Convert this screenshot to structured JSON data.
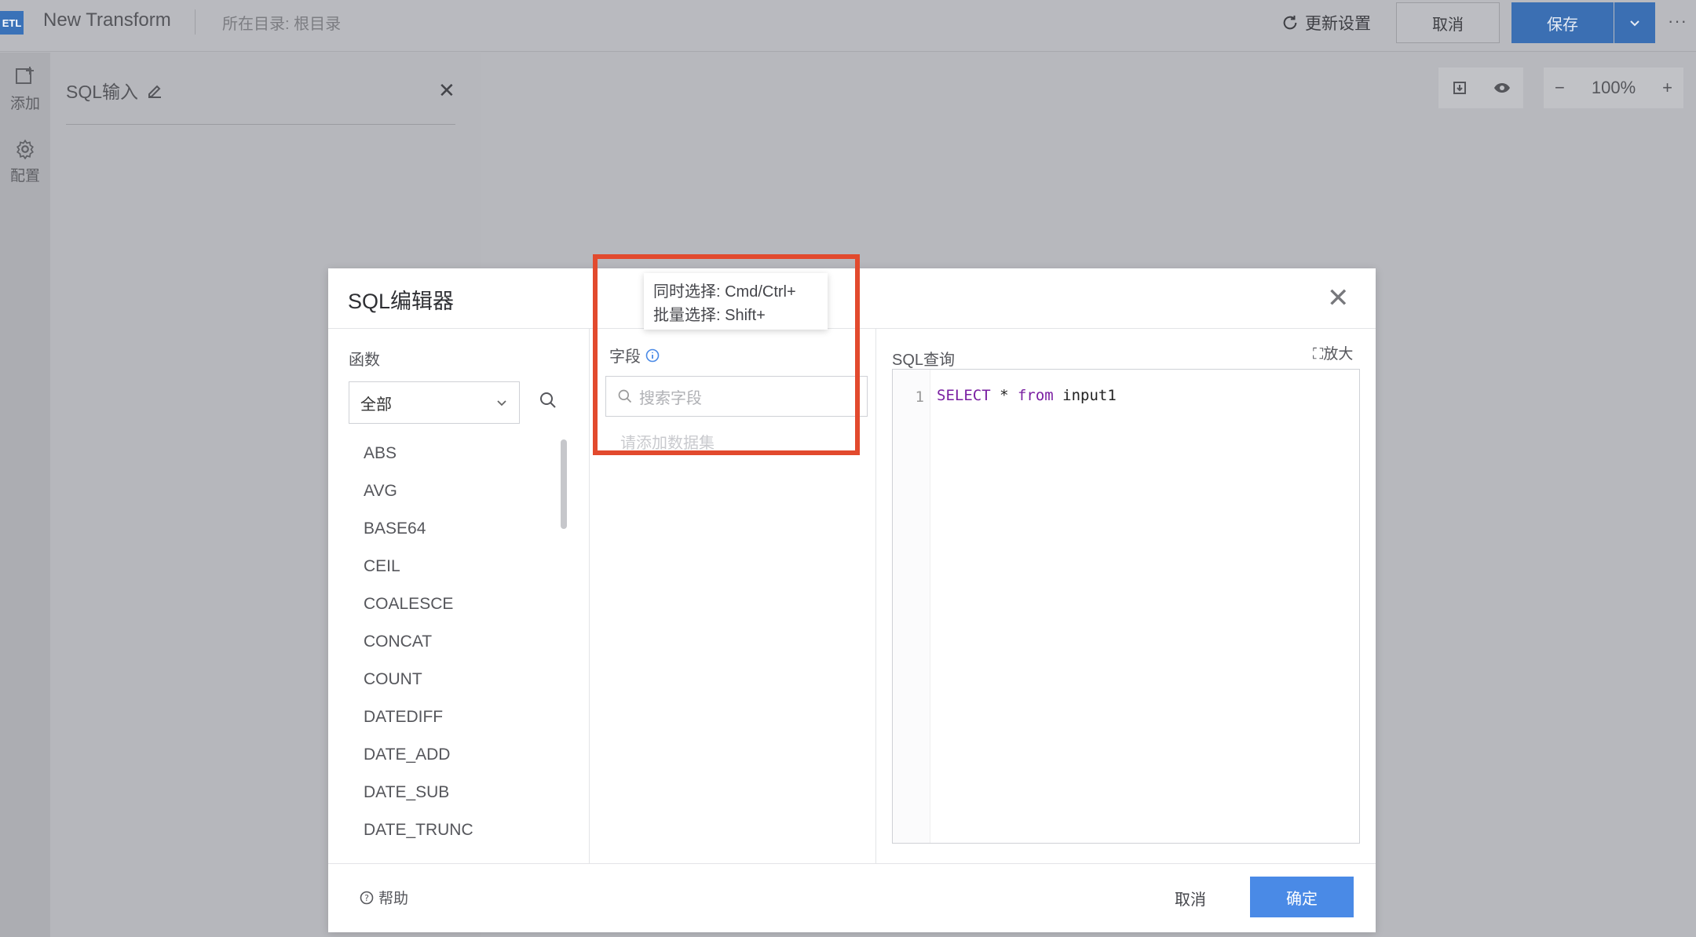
{
  "topbar": {
    "logo": "ETL",
    "title": "New Transform",
    "directory": "所在目录: 根目录",
    "refresh_label": "更新设置",
    "cancel_label": "取消",
    "save_label": "保存",
    "more": "···"
  },
  "rail": {
    "add_label": "添加",
    "config_label": "配置"
  },
  "node_panel": {
    "title": "SQL输入"
  },
  "canvas": {
    "zoom": "100%"
  },
  "modal": {
    "title": "SQL编辑器",
    "functions_label": "函数",
    "category_selected": "全部",
    "functions": [
      "ABS",
      "AVG",
      "BASE64",
      "CEIL",
      "COALESCE",
      "CONCAT",
      "COUNT",
      "DATEDIFF",
      "DATE_ADD",
      "DATE_SUB",
      "DATE_TRUNC"
    ],
    "fields_label": "字段",
    "field_search_placeholder": "搜索字段",
    "fields_empty": "请添加数据集",
    "tooltip_line1": "同时选择: Cmd/Ctrl+",
    "tooltip_line2": "批量选择: Shift+",
    "query_label": "SQL查询",
    "expand_label": "放大",
    "code_line_number": "1",
    "code_select": "SELECT",
    "code_star": " * ",
    "code_from": "from",
    "code_table": " input1",
    "help_label": "帮助",
    "cancel_label": "取消",
    "confirm_label": "确定"
  }
}
